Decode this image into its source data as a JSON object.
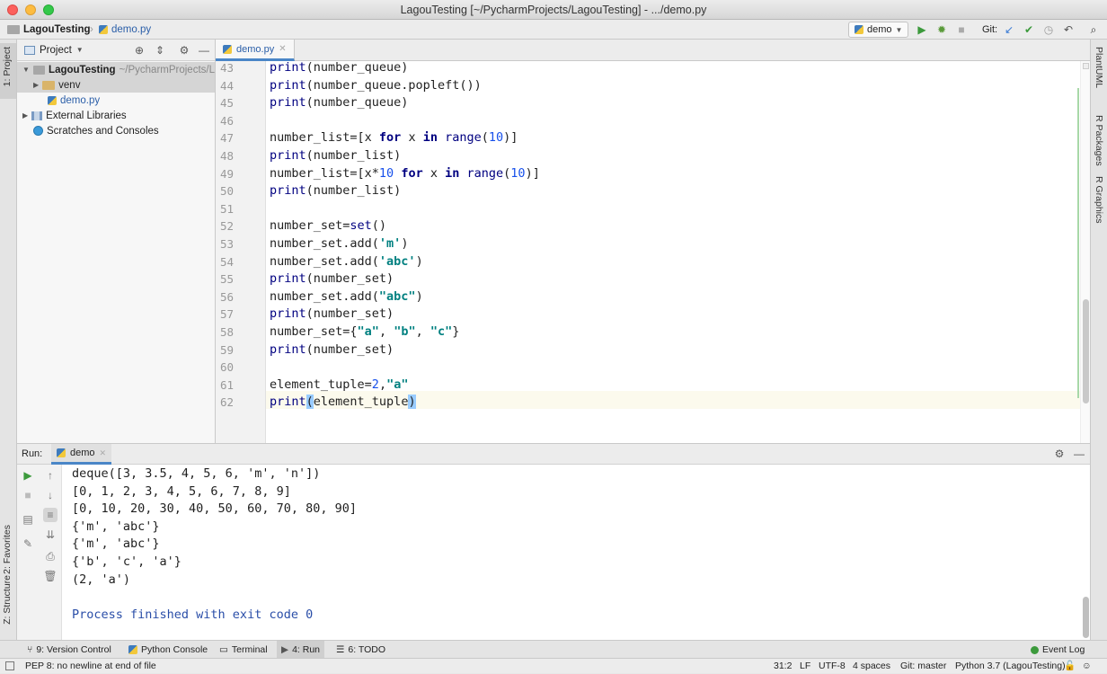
{
  "window": {
    "title": "LagouTesting [~/PycharmProjects/LagouTesting] - .../demo.py"
  },
  "navbar": {
    "project": "LagouTesting",
    "file": "demo.py",
    "run_config": "demo",
    "git_label": "Git:"
  },
  "left_strip": {
    "project_tab": "1: Project",
    "favorites_tab": "2: Favorites",
    "structure_tab": "Z: Structure"
  },
  "right_strip": {
    "plantuml": "PlantUML",
    "r_packages": "R Packages",
    "r_graphics": "R Graphics"
  },
  "project_panel": {
    "header": "Project",
    "root": {
      "name": "LagouTesting",
      "path": "~/PycharmProjects/L"
    },
    "venv": "venv",
    "file": "demo.py",
    "external": "External Libraries",
    "scratches": "Scratches and Consoles"
  },
  "editor": {
    "tab": "demo.py",
    "current_line": 62,
    "lines": [
      {
        "n": "43",
        "code": "print(number_queue)"
      },
      {
        "n": "44",
        "code": "print(number_queue.popleft())"
      },
      {
        "n": "45",
        "code": "print(number_queue)"
      },
      {
        "n": "46",
        "code": ""
      },
      {
        "n": "47",
        "code": "number_list=[x for x in range(10)]"
      },
      {
        "n": "48",
        "code": "print(number_list)"
      },
      {
        "n": "49",
        "code": "number_list=[x*10 for x in range(10)]"
      },
      {
        "n": "50",
        "code": "print(number_list)"
      },
      {
        "n": "51",
        "code": ""
      },
      {
        "n": "52",
        "code": "number_set=set()"
      },
      {
        "n": "53",
        "code": "number_set.add('m')"
      },
      {
        "n": "54",
        "code": "number_set.add('abc')"
      },
      {
        "n": "55",
        "code": "print(number_set)"
      },
      {
        "n": "56",
        "code": "number_set.add(\"abc\")"
      },
      {
        "n": "57",
        "code": "print(number_set)"
      },
      {
        "n": "58",
        "code": "number_set={\"a\", \"b\", \"c\"}"
      },
      {
        "n": "59",
        "code": "print(number_set)"
      },
      {
        "n": "60",
        "code": ""
      },
      {
        "n": "61",
        "code": "element_tuple=2,\"a\""
      },
      {
        "n": "62",
        "code": "print(element_tuple)"
      }
    ]
  },
  "run_panel": {
    "label": "Run:",
    "tab": "demo",
    "output": [
      "deque([3, 3.5, 4, 5, 6, 'm', 'n'])",
      "[0, 1, 2, 3, 4, 5, 6, 7, 8, 9]",
      "[0, 10, 20, 30, 40, 50, 60, 70, 80, 90]",
      "{'m', 'abc'}",
      "{'m', 'abc'}",
      "{'b', 'c', 'a'}",
      "(2, 'a')",
      "",
      "Process finished with exit code 0"
    ]
  },
  "bottom_tabs": [
    {
      "label": "9: Version Control"
    },
    {
      "label": "Python Console"
    },
    {
      "label": "Terminal"
    },
    {
      "label": "4: Run"
    },
    {
      "label": "6: TODO"
    }
  ],
  "event_log": "Event Log",
  "status": {
    "message": "PEP 8: no newline at end of file",
    "position": "31:2",
    "line_sep": "LF",
    "encoding": "UTF-8",
    "indent": "4 spaces",
    "git": "Git: master",
    "interpreter": "Python 3.7 (LagouTesting)"
  },
  "colors": {
    "accent": "#4a86c7",
    "keyword": "#000080",
    "number": "#1750eb",
    "string": "#008080"
  }
}
